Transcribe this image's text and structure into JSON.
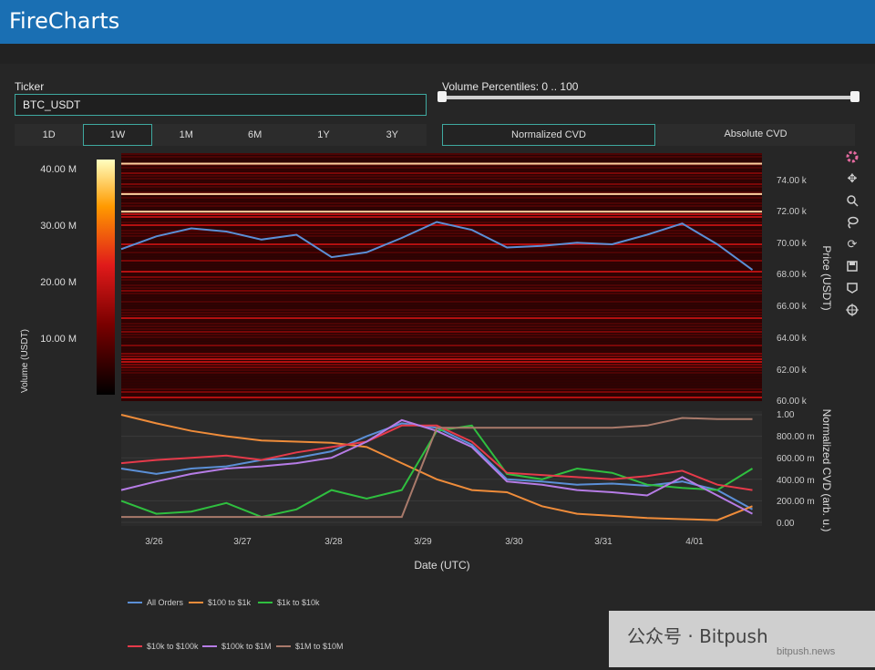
{
  "app": {
    "title": "FireCharts"
  },
  "controls": {
    "ticker_label": "Ticker",
    "ticker_value": "BTC_USDT",
    "volume_label": "Volume Percentiles: 0 .. 100",
    "timeframes": [
      "1D",
      "1W",
      "1M",
      "6M",
      "1Y",
      "3Y"
    ],
    "active_timeframe": "1W",
    "modes": [
      "Normalized CVD",
      "Absolute CVD"
    ],
    "active_mode": "Normalized CVD"
  },
  "colors": {
    "all_orders": "#5b8fd6",
    "o100_1k": "#ef8c3a",
    "o1k_10k": "#2fbf3f",
    "o10k_100k": "#e63a4a",
    "o100k_1m": "#b67ce6",
    "o1m_10m": "#a97a6b",
    "accent": "#3fa9a0",
    "header": "#1a6fb3"
  },
  "toolbar_icons": [
    "plotly-logo-icon",
    "pan-icon",
    "zoom-icon",
    "lasso-icon",
    "reset-icon",
    "download-icon",
    "hover-icon",
    "spike-icon"
  ],
  "chart_data": [
    {
      "type": "heatmap",
      "title": "",
      "colorbar_title": "Volume (USDT)",
      "colorbar_ticks": [
        "40.00 M",
        "30.00 M",
        "20.00 M",
        "10.00 M"
      ],
      "colorbar_range": [
        0,
        42000000
      ],
      "ylabel": "Price (USDT)",
      "y_ticks": [
        "74.00 k",
        "72.00 k",
        "70.00 k",
        "68.00 k",
        "66.00 k",
        "64.00 k",
        "62.00 k",
        "60.00 k"
      ],
      "ylim": [
        60000,
        75500
      ],
      "price_series": {
        "x": [
          "3/25 14:00",
          "3/26 00:00",
          "3/26 10:00",
          "3/26 20:00",
          "3/27 06:00",
          "3/27 16:00",
          "3/28 00:00",
          "3/28 10:00",
          "3/28 20:00",
          "3/29 06:00",
          "3/29 16:00",
          "3/30 00:00",
          "3/30 10:00",
          "3/30 20:00",
          "3/31 06:00",
          "3/31 16:00",
          "4/01 00:00",
          "4/01 08:00",
          "4/01 16:00"
        ],
        "y": [
          69500,
          70300,
          70800,
          70600,
          70100,
          70400,
          69000,
          69300,
          70200,
          71200,
          70700,
          69600,
          69700,
          69900,
          69800,
          70400,
          71100,
          69800,
          68200
        ]
      }
    },
    {
      "type": "line",
      "xlabel": "Date (UTC)",
      "ylabel": "Normalized CVD (arb. u.)",
      "x_ticks": [
        "3/26",
        "3/27",
        "3/28",
        "3/29",
        "3/30",
        "3/31",
        "4/01"
      ],
      "y_ticks": [
        "1.00",
        "800.00 m",
        "600.00 m",
        "400.00 m",
        "200.00 m",
        "0.00"
      ],
      "ylim": [
        0,
        1
      ],
      "legend_placement": "bottom",
      "x": [
        "3/25 14:00",
        "3/26 00:00",
        "3/26 10:00",
        "3/26 20:00",
        "3/27 06:00",
        "3/27 16:00",
        "3/28 00:00",
        "3/28 10:00",
        "3/28 20:00",
        "3/29 06:00",
        "3/29 16:00",
        "3/30 00:00",
        "3/30 10:00",
        "3/30 20:00",
        "3/31 06:00",
        "3/31 16:00",
        "4/01 00:00",
        "4/01 08:00",
        "4/01 16:00"
      ],
      "series": [
        {
          "name": "All Orders",
          "values": [
            0.5,
            0.45,
            0.5,
            0.52,
            0.58,
            0.6,
            0.66,
            0.8,
            0.92,
            0.88,
            0.72,
            0.4,
            0.38,
            0.35,
            0.36,
            0.34,
            0.38,
            0.3,
            0.12
          ]
        },
        {
          "name": "$100 to $1k",
          "values": [
            1.0,
            0.92,
            0.85,
            0.8,
            0.76,
            0.75,
            0.74,
            0.7,
            0.55,
            0.4,
            0.3,
            0.28,
            0.15,
            0.08,
            0.06,
            0.04,
            0.03,
            0.02,
            0.15
          ]
        },
        {
          "name": "$1k to $10k",
          "values": [
            0.2,
            0.08,
            0.1,
            0.18,
            0.05,
            0.12,
            0.3,
            0.22,
            0.3,
            0.85,
            0.9,
            0.45,
            0.4,
            0.5,
            0.46,
            0.35,
            0.32,
            0.3,
            0.5
          ]
        },
        {
          "name": "$10k to $100k",
          "values": [
            0.55,
            0.58,
            0.6,
            0.62,
            0.58,
            0.65,
            0.7,
            0.75,
            0.9,
            0.9,
            0.75,
            0.46,
            0.44,
            0.42,
            0.4,
            0.43,
            0.48,
            0.35,
            0.3
          ]
        },
        {
          "name": "$100k to $1M",
          "values": [
            0.3,
            0.38,
            0.45,
            0.5,
            0.52,
            0.55,
            0.6,
            0.75,
            0.95,
            0.85,
            0.7,
            0.38,
            0.35,
            0.3,
            0.28,
            0.25,
            0.42,
            0.25,
            0.08
          ]
        },
        {
          "name": "$1M to $10M",
          "values": [
            0.05,
            0.05,
            0.05,
            0.05,
            0.05,
            0.05,
            0.05,
            0.05,
            0.05,
            0.88,
            0.88,
            0.88,
            0.88,
            0.88,
            0.88,
            0.9,
            0.97,
            0.96,
            0.96
          ]
        }
      ]
    }
  ]
}
